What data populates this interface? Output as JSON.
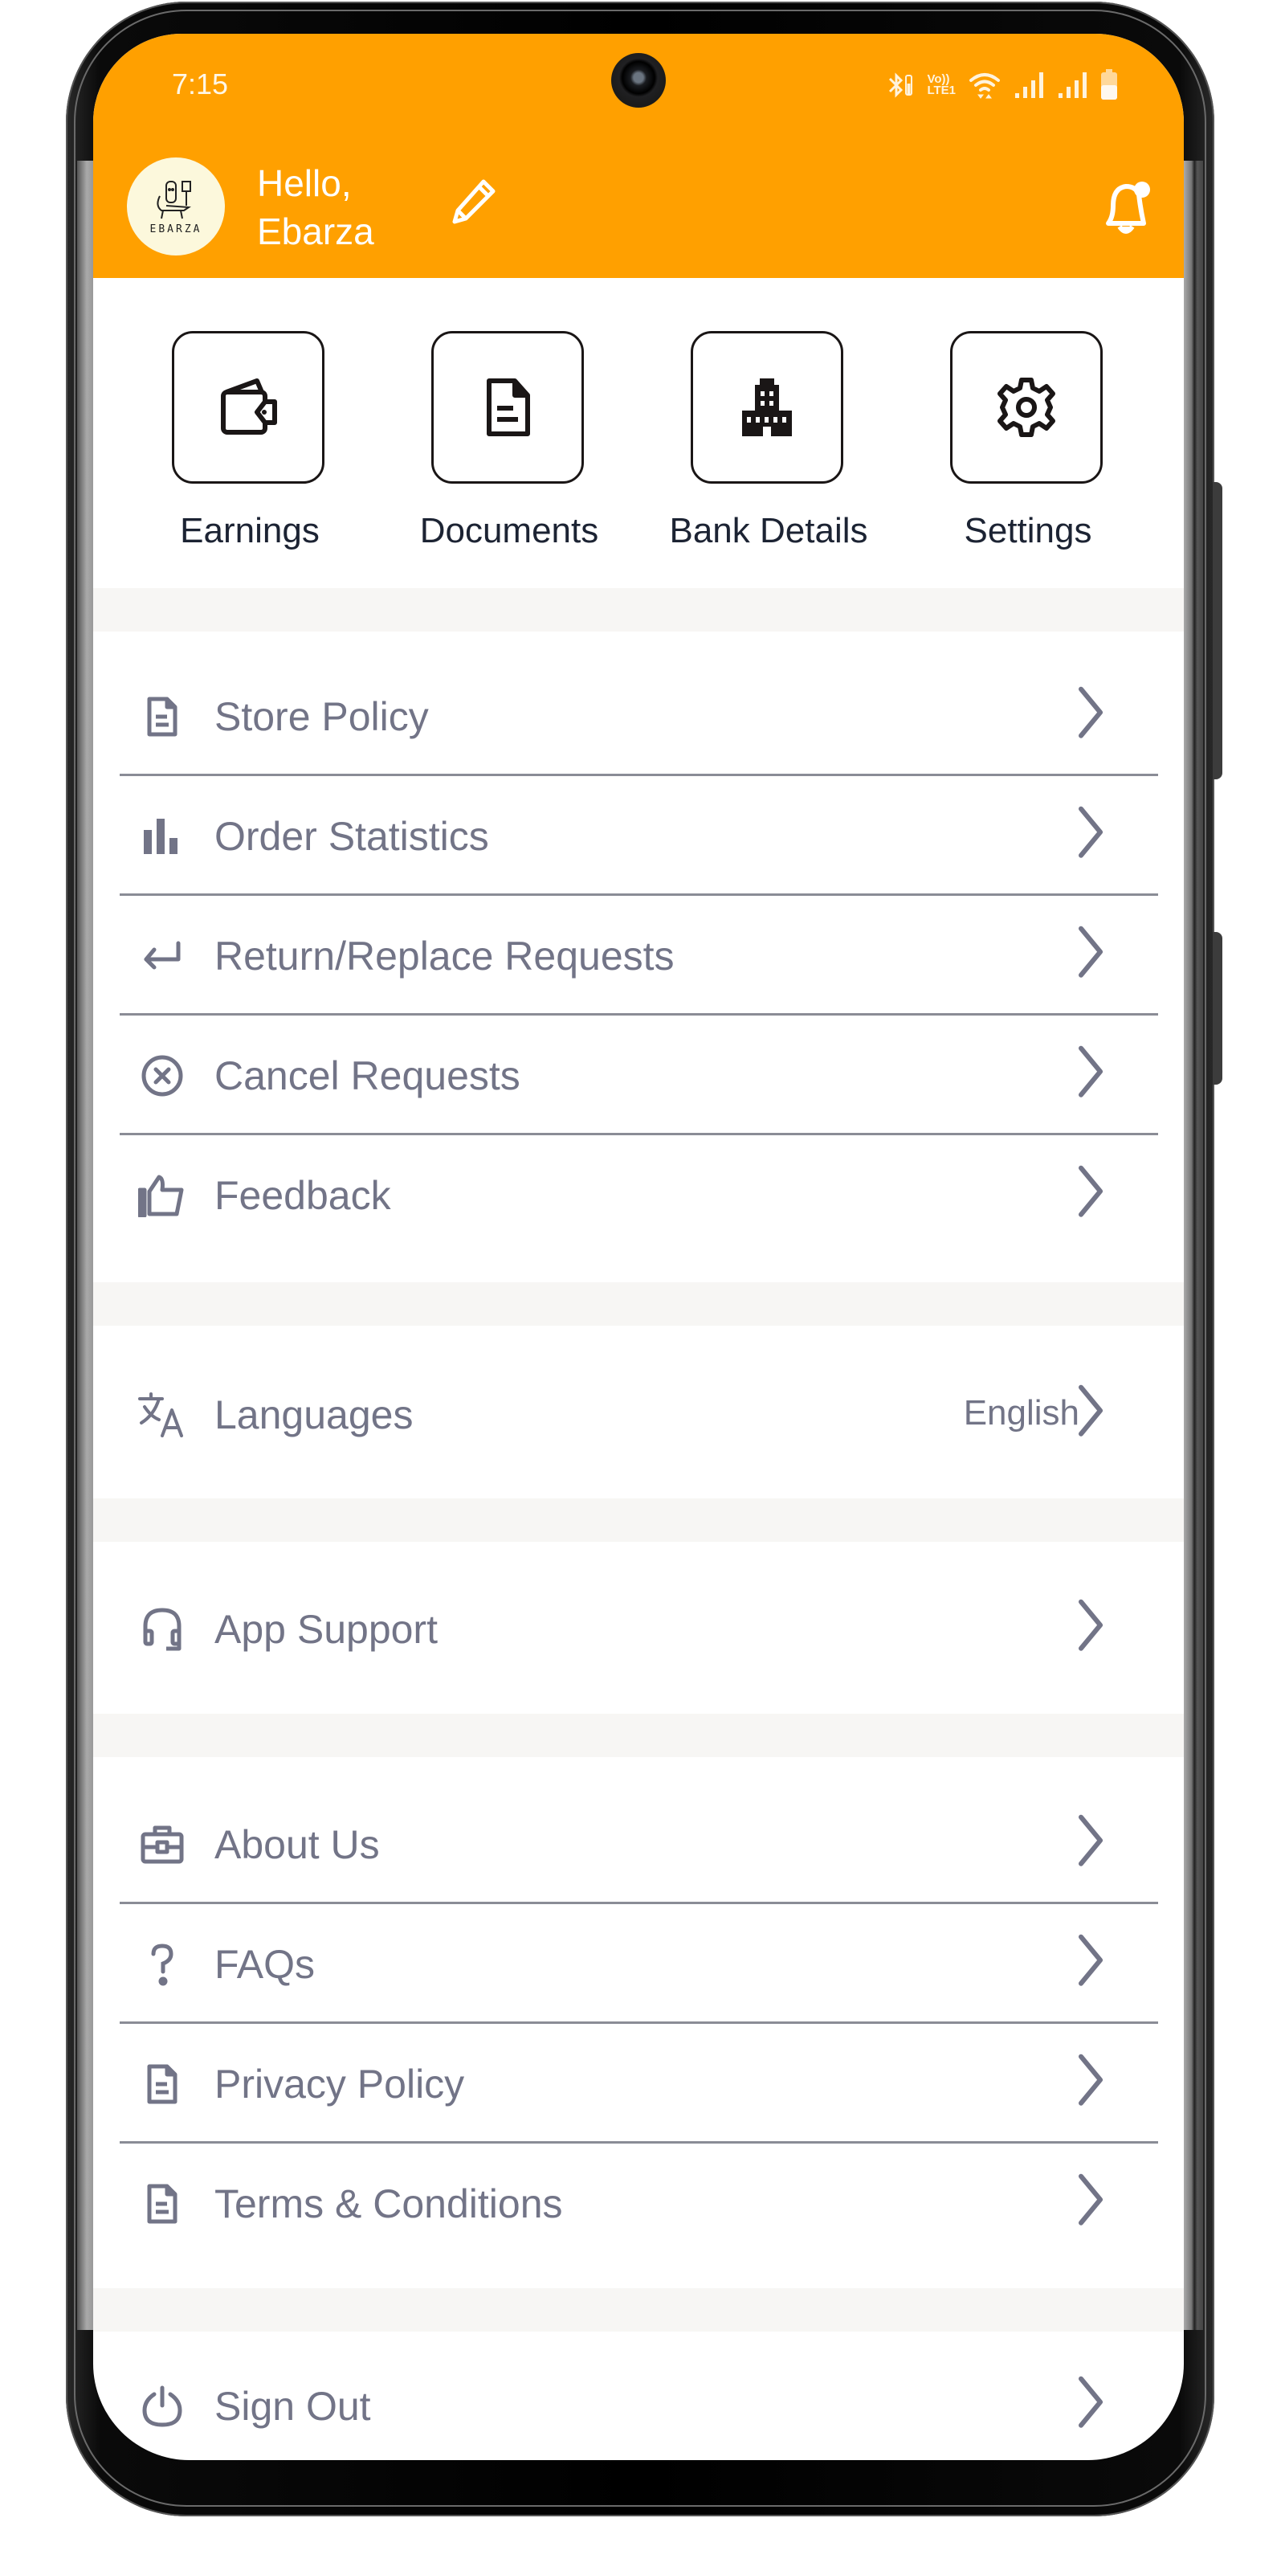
{
  "status_bar": {
    "time": "7:15",
    "icons": [
      "bluetooth-icon",
      "volte-lte1-icon",
      "wifi-icon",
      "signal-icon",
      "signal-icon",
      "battery-icon"
    ],
    "volte_label_top": "Vo))",
    "volte_label_bottom": "LTE1"
  },
  "header": {
    "background": "#ffa000",
    "greeting_line1": "Hello,",
    "greeting_line2": "Ebarza",
    "avatar_logo_text": "EBARZA",
    "edit_icon": "pencil-icon",
    "notification_icon": "bell-icon"
  },
  "quick_actions": [
    {
      "label": "Earnings",
      "icon": "wallet-icon"
    },
    {
      "label": "Documents",
      "icon": "document-icon"
    },
    {
      "label": "Bank Details",
      "icon": "building-icon"
    },
    {
      "label": "Settings",
      "icon": "gear-icon"
    }
  ],
  "menu": {
    "section1": [
      {
        "label": "Store Policy",
        "icon": "document-icon"
      },
      {
        "label": "Order Statistics",
        "icon": "bar-chart-icon"
      },
      {
        "label": "Return/Replace Requests",
        "icon": "return-arrow-icon"
      },
      {
        "label": "Cancel Requests",
        "icon": "cancel-circle-icon"
      },
      {
        "label": "Feedback",
        "icon": "thumbs-up-icon"
      }
    ],
    "section2": [
      {
        "label": "Languages",
        "icon": "translate-icon",
        "value": "English"
      }
    ],
    "section3": [
      {
        "label": "App Support",
        "icon": "headset-icon"
      }
    ],
    "section4": [
      {
        "label": "About Us",
        "icon": "briefcase-icon"
      },
      {
        "label": "FAQs",
        "icon": "question-icon"
      },
      {
        "label": "Privacy Policy",
        "icon": "document-icon"
      },
      {
        "label": "Terms & Conditions",
        "icon": "document-icon"
      }
    ],
    "section5": [
      {
        "label": "Sign Out",
        "icon": "power-icon"
      }
    ]
  },
  "colors": {
    "accent": "#ffa000",
    "menu_text": "#727487",
    "tile_text": "#1c2333",
    "separator_band": "#f7f6f4"
  }
}
